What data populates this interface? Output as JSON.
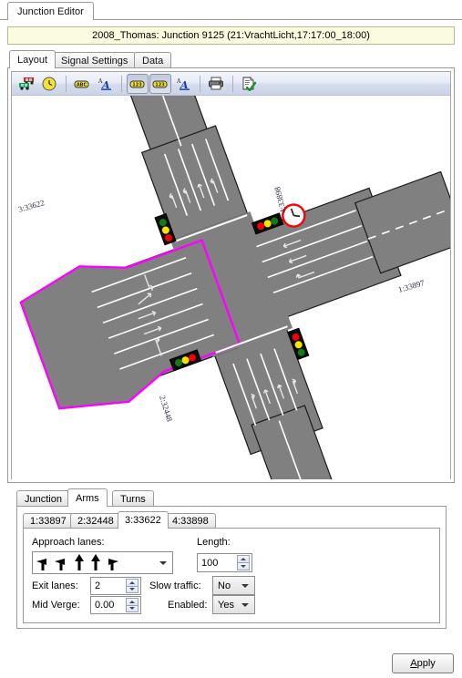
{
  "window": {
    "tab_label": "Junction Editor",
    "title_banner": "2008_Thomas: Junction 9125 (21:VrachtLicht,17:17:00_18:00)"
  },
  "main_tabs": [
    {
      "label": "Layout",
      "selected": true
    },
    {
      "label": "Signal Settings",
      "selected": false
    },
    {
      "label": "Data",
      "selected": false
    }
  ],
  "toolbar": {
    "buttons": [
      {
        "name": "vehicles-icon",
        "title": "Vehicles",
        "pressed": false
      },
      {
        "name": "clock-icon",
        "title": "Timing",
        "pressed": false
      },
      {
        "name": "abc-label-icon",
        "title": "Text labels",
        "pressed": false
      },
      {
        "name": "text-font-icon",
        "title": "Label font",
        "pressed": false
      },
      {
        "name": "numeric-label-icon-1",
        "title": "Numeric labels 1",
        "pressed": true
      },
      {
        "name": "numeric-label-icon-2",
        "title": "Numeric labels 2",
        "pressed": true
      },
      {
        "name": "numeric-font-icon",
        "title": "Numeric font",
        "pressed": false
      },
      {
        "name": "print-icon",
        "title": "Print",
        "pressed": false
      },
      {
        "name": "validate-icon",
        "title": "Check / validate",
        "pressed": false
      }
    ]
  },
  "diagram": {
    "arm_labels": [
      {
        "name": "arm-label-north",
        "text": "4:33898"
      },
      {
        "name": "arm-label-east",
        "text": "1:33897"
      },
      {
        "name": "arm-label-south",
        "text": "2:32448"
      },
      {
        "name": "arm-label-west",
        "text": "3:33622"
      }
    ],
    "selection_color": "#ff00ff",
    "road_color": "#808080",
    "signals": [
      {
        "name": "signal-north",
        "orientation": "vertical",
        "order": "green-yellow-red"
      },
      {
        "name": "signal-east",
        "orientation": "horizontal",
        "order": "red-yellow-green"
      },
      {
        "name": "signal-west",
        "orientation": "horizontal",
        "order": "green-yellow-red"
      },
      {
        "name": "signal-south",
        "orientation": "vertical",
        "order": "red-yellow-green"
      }
    ],
    "highlight_marker": {
      "name": "clock-marker-icon",
      "color": "#ff0000"
    }
  },
  "lower_tabs": [
    {
      "label": "Junction",
      "selected": false
    },
    {
      "label": "Arms",
      "selected": true
    },
    {
      "label": "Turns",
      "selected": false
    }
  ],
  "arm_tabs": [
    {
      "label": "1:33897",
      "selected": false
    },
    {
      "label": "2:32448",
      "selected": false
    },
    {
      "label": "3:33622",
      "selected": true
    },
    {
      "label": "4:33898",
      "selected": false
    }
  ],
  "arm_form": {
    "approach_lanes_label": "Approach lanes:",
    "approach_lanes_value": "left, left, ahead, ahead, right",
    "approach_lane_arrows": [
      "left",
      "left",
      "ahead",
      "ahead",
      "right"
    ],
    "length_label": "Length:",
    "length_value": "100",
    "exit_lanes_label": "Exit lanes:",
    "exit_lanes_value": "2",
    "mid_verge_label": "Mid Verge:",
    "mid_verge_value": "0.00",
    "slow_traffic_label": "Slow traffic:",
    "slow_traffic_value": "No",
    "enabled_label": "Enabled:",
    "enabled_value": "Yes"
  },
  "footer": {
    "apply_label": "Apply",
    "apply_mnemonic": "A",
    "apply_rest": "pply"
  }
}
